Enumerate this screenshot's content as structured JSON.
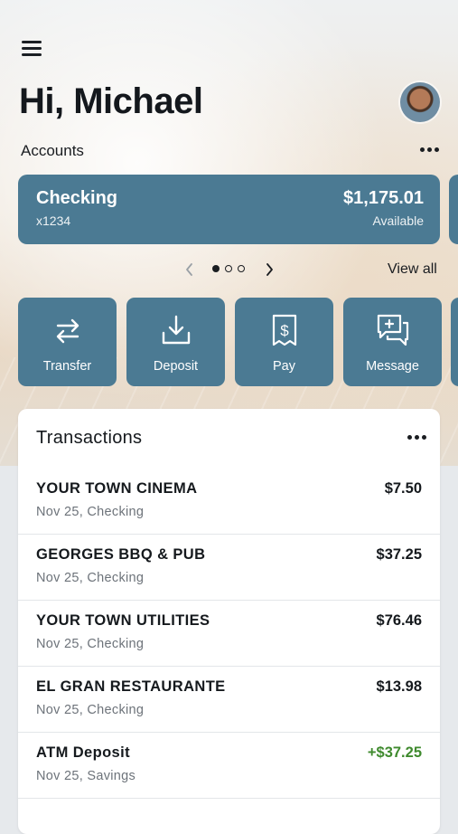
{
  "header": {
    "greeting": "Hi, Michael",
    "menu_icon": "hamburger-menu-icon",
    "avatar": "user-avatar"
  },
  "accounts": {
    "label": "Accounts",
    "card": {
      "name": "Checking",
      "number": "x1234",
      "balance": "$1,175.01",
      "balance_label": "Available"
    },
    "pager": {
      "total": 3,
      "active": 1
    },
    "view_all": "View all"
  },
  "actions": [
    {
      "label": "Transfer",
      "icon": "transfer-icon"
    },
    {
      "label": "Deposit",
      "icon": "deposit-icon"
    },
    {
      "label": "Pay",
      "icon": "pay-icon"
    },
    {
      "label": "Message",
      "icon": "message-icon"
    }
  ],
  "transactions": {
    "title": "Transactions",
    "items": [
      {
        "merchant": "YOUR TOWN CINEMA",
        "meta": "Nov 25, Checking",
        "amount": "$7.50",
        "credit": false
      },
      {
        "merchant": "GEORGES BBQ & PUB",
        "meta": "Nov 25, Checking",
        "amount": "$37.25",
        "credit": false
      },
      {
        "merchant": "YOUR TOWN UTILITIES",
        "meta": "Nov 25, Checking",
        "amount": "$76.46",
        "credit": false
      },
      {
        "merchant": "EL GRAN RESTAURANTE",
        "meta": "Nov 25, Checking",
        "amount": "$13.98",
        "credit": false
      },
      {
        "merchant": "ATM Deposit",
        "meta": "Nov 25, Savings",
        "amount": "+$37.25",
        "credit": true
      }
    ]
  },
  "colors": {
    "accent": "#4b7a93",
    "credit": "#3f8a2e",
    "text": "#15191d"
  }
}
